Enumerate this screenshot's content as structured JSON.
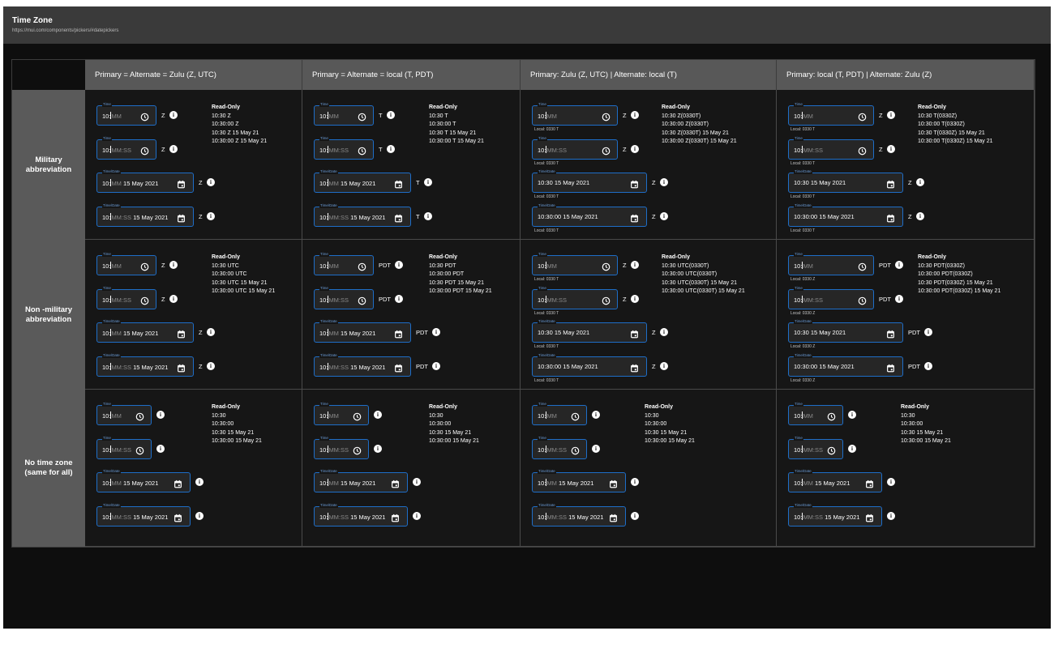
{
  "header": {
    "title": "Time Zone",
    "url": "https://mui.com/components/pickers/#datepickers"
  },
  "columns": [
    "Primary = Alternate = Zulu (Z, UTC)",
    "Primary = Alternate = local (T, PDT)",
    "Primary: Zulu (Z, UTC) | Alternate: local (T)",
    "Primary: local (T, PDT) | Alternate: Zulu (Z)"
  ],
  "rows": [
    "Military\nabbreviation",
    "Non -military\nabbreviation",
    "No time zone\n(same for all)"
  ],
  "field_labels": {
    "time": "Time",
    "timedate": "Time/Date"
  },
  "read_only_title": "Read-Only",
  "cells": [
    [
      {
        "inputs": [
          {
            "type": "time",
            "prefix": "10:",
            "ph": "MM",
            "tz": "Z"
          },
          {
            "type": "time",
            "prefix": "10:",
            "ph": "MM:SS",
            "tz": "Z"
          },
          {
            "type": "timedate",
            "prefix": "10:",
            "ph": "MM",
            "date": " 15 May 2021",
            "tz": "Z"
          },
          {
            "type": "timedate",
            "prefix": "10:",
            "ph": "MM:SS",
            "date": " 15 May 2021",
            "tz": "Z"
          }
        ],
        "readonly": [
          "10:30 Z",
          "10:30:00 Z",
          "10:30 Z 15 May 21",
          "10:30:00 Z 15 May 21"
        ]
      },
      {
        "inputs": [
          {
            "type": "time",
            "prefix": "10:",
            "ph": "MM",
            "tz": "T"
          },
          {
            "type": "time",
            "prefix": "10:",
            "ph": "MM:SS",
            "tz": "T"
          },
          {
            "type": "timedate",
            "prefix": "10:",
            "ph": "MM",
            "date": " 15 May 2021",
            "tz": "T"
          },
          {
            "type": "timedate",
            "prefix": "10:",
            "ph": "MM:SS",
            "date": " 15 May 2021",
            "tz": "T"
          }
        ],
        "readonly": [
          "10:30 T",
          "10:30:00 T",
          "10:30 T 15 May 21",
          "10:30:00 T 15 May 21"
        ]
      },
      {
        "inputs": [
          {
            "type": "time",
            "prefix": "10:",
            "ph": "MM",
            "tz": "Z",
            "local": "Local: 0330 T"
          },
          {
            "type": "time",
            "prefix": "10:",
            "ph": "MM:SS",
            "tz": "Z",
            "local": "Local: 0330 T"
          },
          {
            "type": "timedate",
            "prefix": "10:30 15 May 2021",
            "ph": "",
            "date": "",
            "tz": "Z",
            "local": "Local: 0330 T"
          },
          {
            "type": "timedate",
            "prefix": "10:30:00 15 May 2021",
            "ph": "",
            "date": "",
            "tz": "Z",
            "local": "Local: 0330 T"
          }
        ],
        "readonly": [
          "10:30 Z(0330T)",
          "10:30:00 Z(0330T)",
          "10:30 Z(0330T) 15 May 21",
          "10:30:00 Z(0330T) 15 May 21"
        ]
      },
      {
        "inputs": [
          {
            "type": "time",
            "prefix": "10:",
            "ph": "MM",
            "tz": "Z",
            "local": "Local: 0330 T"
          },
          {
            "type": "time",
            "prefix": "10:",
            "ph": "MM:SS",
            "tz": "Z",
            "local": "Local: 0330 T"
          },
          {
            "type": "timedate",
            "prefix": "10:30 15 May 2021",
            "ph": "",
            "date": "",
            "tz": "Z",
            "local": "Local: 0330 T"
          },
          {
            "type": "timedate",
            "prefix": "10:30:00 15 May 2021",
            "ph": "",
            "date": "",
            "tz": "Z",
            "local": "Local: 0330 T"
          }
        ],
        "readonly": [
          "10:30 T(0330Z)",
          "10:30:00 T(0330Z)",
          "10:30 T(0330Z) 15 May 21",
          "10:30:00 T(0330Z) 15 May 21"
        ]
      }
    ],
    [
      {
        "inputs": [
          {
            "type": "time",
            "prefix": "10:",
            "ph": "MM",
            "tz": "Z"
          },
          {
            "type": "time",
            "prefix": "10:",
            "ph": "MM:SS",
            "tz": "Z"
          },
          {
            "type": "timedate",
            "prefix": "10:",
            "ph": "MM",
            "date": " 15 May 2021",
            "tz": "Z"
          },
          {
            "type": "timedate",
            "prefix": "10:",
            "ph": "MM:SS",
            "date": " 15 May 2021",
            "tz": "Z"
          }
        ],
        "readonly": [
          "10:30 UTC",
          "10:30:00 UTC",
          "10:30 UTC 15 May 21",
          "10:30:00 UTC 15 May 21"
        ]
      },
      {
        "inputs": [
          {
            "type": "time",
            "prefix": "10:",
            "ph": "MM",
            "tz": "PDT"
          },
          {
            "type": "time",
            "prefix": "10:",
            "ph": "MM:SS",
            "tz": "PDT"
          },
          {
            "type": "timedate",
            "prefix": "10:",
            "ph": "MM",
            "date": " 15 May 2021",
            "tz": "PDT"
          },
          {
            "type": "timedate",
            "prefix": "10:",
            "ph": "MM:SS",
            "date": " 15 May 2021",
            "tz": "PDT"
          }
        ],
        "readonly": [
          "10:30 PDT",
          "10:30:00 PDT",
          "10:30 PDT 15 May 21",
          "10:30:00 PDT 15 May 21"
        ]
      },
      {
        "inputs": [
          {
            "type": "time",
            "prefix": "10:",
            "ph": "MM",
            "tz": "Z",
            "local": "Local: 0330 T"
          },
          {
            "type": "time",
            "prefix": "10:",
            "ph": "MM:SS",
            "tz": "Z",
            "local": "Local: 0330 T"
          },
          {
            "type": "timedate",
            "prefix": "10:30 15 May 2021",
            "ph": "",
            "date": "",
            "tz": "Z",
            "local": "Local: 0330 T"
          },
          {
            "type": "timedate",
            "prefix": "10:30:00 15 May 2021",
            "ph": "",
            "date": "",
            "tz": "Z",
            "local": "Local: 0330 T"
          }
        ],
        "readonly": [
          "10:30 UTC(0330T)",
          "10:30:00 UTC(0330T)",
          "10:30 UTC(0330T) 15 May 21",
          "10:30:00 UTC(0330T) 15 May 21"
        ]
      },
      {
        "inputs": [
          {
            "type": "time",
            "prefix": "10:",
            "ph": "MM",
            "tz": "PDT",
            "local": "Local: 0330 Z"
          },
          {
            "type": "time",
            "prefix": "10:",
            "ph": "MM:SS",
            "tz": "PDT",
            "local": "Local: 0330 Z"
          },
          {
            "type": "timedate",
            "prefix": "10:30 15 May 2021",
            "ph": "",
            "date": "",
            "tz": "PDT",
            "local": "Local: 0330 Z"
          },
          {
            "type": "timedate",
            "prefix": "10:30:00 15 May 2021",
            "ph": "",
            "date": "",
            "tz": "PDT",
            "local": "Local: 0330 Z"
          }
        ],
        "readonly": [
          "10:30 PDT(0330Z)",
          "10:30:00 PDT(0330Z)",
          "10:30 PDT(0330Z) 15 May 21",
          "10:30:00 PDT(0330Z) 15 May 21"
        ]
      }
    ],
    [
      {
        "inputs": [
          {
            "type": "time",
            "prefix": "10:",
            "ph": "MM",
            "tz": ""
          },
          {
            "type": "time",
            "prefix": "10:",
            "ph": "MM:SS",
            "tz": ""
          },
          {
            "type": "timedate",
            "prefix": "10:",
            "ph": "MM",
            "date": " 15 May 2021",
            "tz": ""
          },
          {
            "type": "timedate",
            "prefix": "10:",
            "ph": "MM:SS",
            "date": " 15 May 2021",
            "tz": ""
          }
        ],
        "readonly": [
          "10:30",
          "10:30:00",
          "10:30 15 May 21",
          "10:30:00 15 May 21"
        ]
      },
      {
        "inputs": [
          {
            "type": "time",
            "prefix": "10:",
            "ph": "MM",
            "tz": ""
          },
          {
            "type": "time",
            "prefix": "10:",
            "ph": "MM:SS",
            "tz": ""
          },
          {
            "type": "timedate",
            "prefix": "10:",
            "ph": "MM",
            "date": " 15 May 2021",
            "tz": ""
          },
          {
            "type": "timedate",
            "prefix": "10:",
            "ph": "MM:SS",
            "date": " 15 May 2021",
            "tz": ""
          }
        ],
        "readonly": [
          "10:30",
          "10:30:00",
          "10:30 15 May 21",
          "10:30:00 15 May 21"
        ]
      },
      {
        "inputs": [
          {
            "type": "time",
            "prefix": "10:",
            "ph": "MM",
            "tz": ""
          },
          {
            "type": "time",
            "prefix": "10:",
            "ph": "MM:SS",
            "tz": ""
          },
          {
            "type": "timedate",
            "prefix": "10:",
            "ph": "MM",
            "date": " 15 May 2021",
            "tz": ""
          },
          {
            "type": "timedate",
            "prefix": "10:",
            "ph": "MM:SS",
            "date": " 15 May 2021",
            "tz": ""
          }
        ],
        "readonly": [
          "10:30",
          "10:30:00",
          "10:30 15 May 21",
          "10:30:00 15 May 21"
        ]
      },
      {
        "inputs": [
          {
            "type": "time",
            "prefix": "10:",
            "ph": "MM",
            "tz": ""
          },
          {
            "type": "time",
            "prefix": "10:",
            "ph": "MM:SS",
            "tz": ""
          },
          {
            "type": "timedate",
            "prefix": "10:",
            "ph": "MM",
            "date": " 15 May 2021",
            "tz": ""
          },
          {
            "type": "timedate",
            "prefix": "10:",
            "ph": "MM:SS",
            "date": " 15 May 2021",
            "tz": ""
          }
        ],
        "readonly": [
          "10:30",
          "10:30:00",
          "10:30 15 May 21",
          "10:30:00 15 May 21"
        ]
      }
    ]
  ]
}
